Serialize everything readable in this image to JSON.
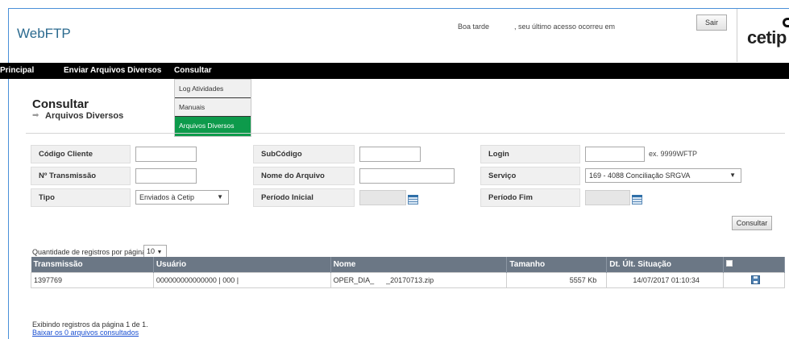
{
  "header": {
    "app_title": "WebFTP",
    "greeting": "Boa tarde",
    "last_access": ", seu último acesso ocorreu em",
    "logout_label": "Sair",
    "logo_text": "cetip"
  },
  "nav": {
    "items": [
      "Principal",
      "Enviar Arquivos Diversos",
      "Consultar"
    ],
    "dropdown": [
      "Log Atividades",
      "Manuais",
      "Arquivos Diversos"
    ]
  },
  "page": {
    "title": "Consultar",
    "breadcrumb": "Arquivos Diversos"
  },
  "form": {
    "codigo_cliente": {
      "label": "Código Cliente",
      "value": ""
    },
    "subcodigo": {
      "label": "SubCódigo",
      "value": ""
    },
    "login": {
      "label": "Login",
      "value": "",
      "hint": "ex. 9999WFTP"
    },
    "n_transmissao": {
      "label": "Nº Transmissão",
      "value": ""
    },
    "nome_arquivo": {
      "label": "Nome do Arquivo",
      "value": ""
    },
    "servico": {
      "label": "Serviço",
      "value": "169 - 4088 Conciliação SRGVA"
    },
    "tipo": {
      "label": "Tipo",
      "value": "Enviados à Cetip"
    },
    "periodo_inicial": {
      "label": "Período Inicial",
      "value": ""
    },
    "periodo_fim": {
      "label": "Período Fim",
      "value": ""
    },
    "submit_label": "Consultar"
  },
  "results": {
    "per_page_label": "Quantidade de registros por página",
    "per_page_value": "10",
    "columns": [
      "Transmissão",
      "Usuário",
      "Nome",
      "Tamanho",
      "Dt. Últ. Situação"
    ],
    "rows": [
      {
        "transmissao": "1397769",
        "usuario": "000000000000000 | 000 |",
        "nome": "OPER_DIA_      _20170713.zip",
        "tamanho": "5557 Kb",
        "dt_situacao": "14/07/2017 01:10:34"
      }
    ],
    "footer_text": "Exibindo registros da página 1 de 1.",
    "download_link": "Baixar os 0 arquivos consultados"
  },
  "colors": {
    "navbar": "#000000",
    "active_menu": "#0d9a4b",
    "table_header": "#6b7785",
    "link": "#1a4fd1"
  }
}
